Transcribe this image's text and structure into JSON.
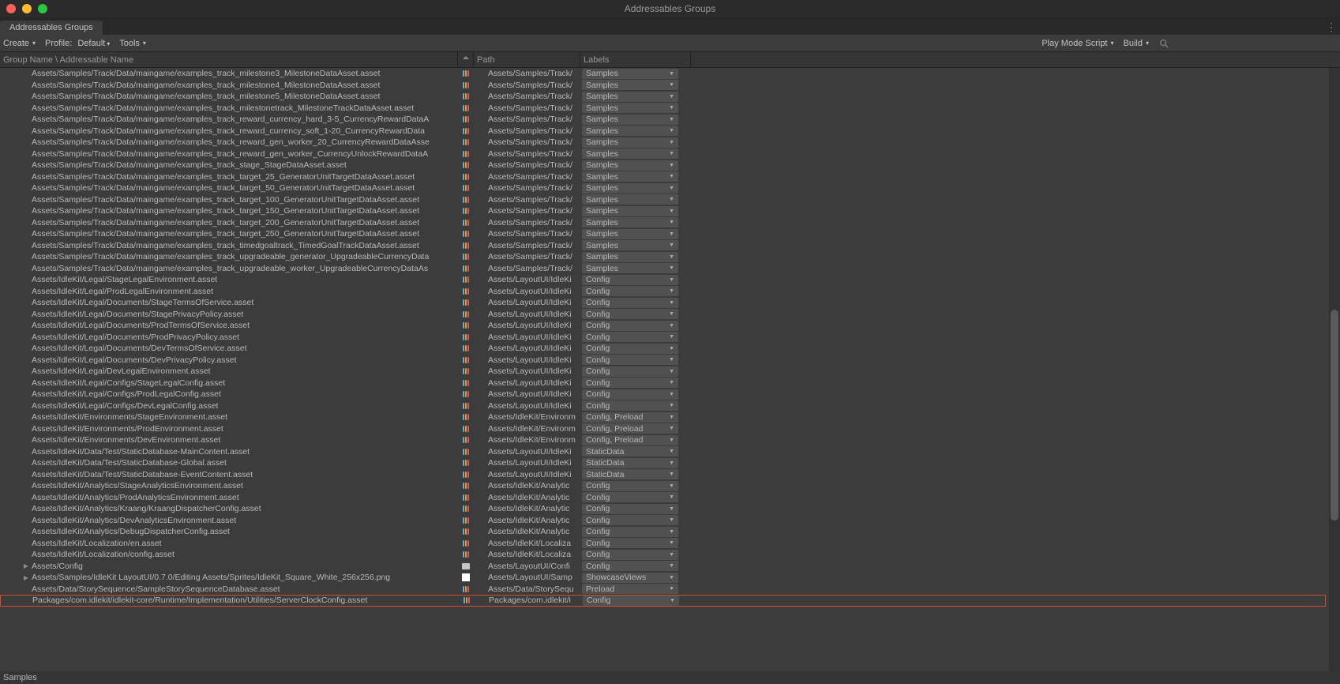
{
  "window": {
    "title": "Addressables Groups"
  },
  "tab": {
    "label": "Addressables Groups"
  },
  "toolbar": {
    "create": "Create",
    "profile_label": "Profile:",
    "profile_value": "Default",
    "tools": "Tools",
    "play_mode": "Play Mode Script",
    "build": "Build"
  },
  "headers": {
    "name": "Group Name \\ Addressable Name",
    "path": "Path",
    "labels": "Labels"
  },
  "rows": [
    {
      "name": "Assets/Samples/Track/Data/maingame/examples_track_milestone3_MilestoneDataAsset.asset",
      "path": "Assets/Samples/Track/",
      "label": "Samples",
      "icon": "asset"
    },
    {
      "name": "Assets/Samples/Track/Data/maingame/examples_track_milestone4_MilestoneDataAsset.asset",
      "path": "Assets/Samples/Track/",
      "label": "Samples",
      "icon": "asset"
    },
    {
      "name": "Assets/Samples/Track/Data/maingame/examples_track_milestone5_MilestoneDataAsset.asset",
      "path": "Assets/Samples/Track/",
      "label": "Samples",
      "icon": "asset"
    },
    {
      "name": "Assets/Samples/Track/Data/maingame/examples_track_milestonetrack_MilestoneTrackDataAsset.asset",
      "path": "Assets/Samples/Track/",
      "label": "Samples",
      "icon": "asset"
    },
    {
      "name": "Assets/Samples/Track/Data/maingame/examples_track_reward_currency_hard_3-5_CurrencyRewardDataA",
      "path": "Assets/Samples/Track/",
      "label": "Samples",
      "icon": "asset"
    },
    {
      "name": "Assets/Samples/Track/Data/maingame/examples_track_reward_currency_soft_1-20_CurrencyRewardData",
      "path": "Assets/Samples/Track/",
      "label": "Samples",
      "icon": "asset"
    },
    {
      "name": "Assets/Samples/Track/Data/maingame/examples_track_reward_gen_worker_20_CurrencyRewardDataAsse",
      "path": "Assets/Samples/Track/",
      "label": "Samples",
      "icon": "asset"
    },
    {
      "name": "Assets/Samples/Track/Data/maingame/examples_track_reward_gen_worker_CurrencyUnlockRewardDataA",
      "path": "Assets/Samples/Track/",
      "label": "Samples",
      "icon": "asset"
    },
    {
      "name": "Assets/Samples/Track/Data/maingame/examples_track_stage_StageDataAsset.asset",
      "path": "Assets/Samples/Track/",
      "label": "Samples",
      "icon": "asset"
    },
    {
      "name": "Assets/Samples/Track/Data/maingame/examples_track_target_25_GeneratorUnitTargetDataAsset.asset",
      "path": "Assets/Samples/Track/",
      "label": "Samples",
      "icon": "asset"
    },
    {
      "name": "Assets/Samples/Track/Data/maingame/examples_track_target_50_GeneratorUnitTargetDataAsset.asset",
      "path": "Assets/Samples/Track/",
      "label": "Samples",
      "icon": "asset"
    },
    {
      "name": "Assets/Samples/Track/Data/maingame/examples_track_target_100_GeneratorUnitTargetDataAsset.asset",
      "path": "Assets/Samples/Track/",
      "label": "Samples",
      "icon": "asset"
    },
    {
      "name": "Assets/Samples/Track/Data/maingame/examples_track_target_150_GeneratorUnitTargetDataAsset.asset",
      "path": "Assets/Samples/Track/",
      "label": "Samples",
      "icon": "asset"
    },
    {
      "name": "Assets/Samples/Track/Data/maingame/examples_track_target_200_GeneratorUnitTargetDataAsset.asset",
      "path": "Assets/Samples/Track/",
      "label": "Samples",
      "icon": "asset"
    },
    {
      "name": "Assets/Samples/Track/Data/maingame/examples_track_target_250_GeneratorUnitTargetDataAsset.asset",
      "path": "Assets/Samples/Track/",
      "label": "Samples",
      "icon": "asset"
    },
    {
      "name": "Assets/Samples/Track/Data/maingame/examples_track_timedgoaltrack_TimedGoalTrackDataAsset.asset",
      "path": "Assets/Samples/Track/",
      "label": "Samples",
      "icon": "asset"
    },
    {
      "name": "Assets/Samples/Track/Data/maingame/examples_track_upgradeable_generator_UpgradeableCurrencyData",
      "path": "Assets/Samples/Track/",
      "label": "Samples",
      "icon": "asset"
    },
    {
      "name": "Assets/Samples/Track/Data/maingame/examples_track_upgradeable_worker_UpgradeableCurrencyDataAs",
      "path": "Assets/Samples/Track/",
      "label": "Samples",
      "icon": "asset"
    },
    {
      "name": "Assets/IdleKit/Legal/StageLegalEnvironment.asset",
      "path": "Assets/LayoutUI/IdleKi",
      "label": "Config",
      "icon": "asset"
    },
    {
      "name": "Assets/IdleKit/Legal/ProdLegalEnvironment.asset",
      "path": "Assets/LayoutUI/IdleKi",
      "label": "Config",
      "icon": "asset"
    },
    {
      "name": "Assets/IdleKit/Legal/Documents/StageTermsOfService.asset",
      "path": "Assets/LayoutUI/IdleKi",
      "label": "Config",
      "icon": "asset"
    },
    {
      "name": "Assets/IdleKit/Legal/Documents/StagePrivacyPolicy.asset",
      "path": "Assets/LayoutUI/IdleKi",
      "label": "Config",
      "icon": "asset"
    },
    {
      "name": "Assets/IdleKit/Legal/Documents/ProdTermsOfService.asset",
      "path": "Assets/LayoutUI/IdleKi",
      "label": "Config",
      "icon": "asset"
    },
    {
      "name": "Assets/IdleKit/Legal/Documents/ProdPrivacyPolicy.asset",
      "path": "Assets/LayoutUI/IdleKi",
      "label": "Config",
      "icon": "asset"
    },
    {
      "name": "Assets/IdleKit/Legal/Documents/DevTermsOfService.asset",
      "path": "Assets/LayoutUI/IdleKi",
      "label": "Config",
      "icon": "asset"
    },
    {
      "name": "Assets/IdleKit/Legal/Documents/DevPrivacyPolicy.asset",
      "path": "Assets/LayoutUI/IdleKi",
      "label": "Config",
      "icon": "asset"
    },
    {
      "name": "Assets/IdleKit/Legal/DevLegalEnvironment.asset",
      "path": "Assets/LayoutUI/IdleKi",
      "label": "Config",
      "icon": "asset"
    },
    {
      "name": "Assets/IdleKit/Legal/Configs/StageLegalConfig.asset",
      "path": "Assets/LayoutUI/IdleKi",
      "label": "Config",
      "icon": "asset"
    },
    {
      "name": "Assets/IdleKit/Legal/Configs/ProdLegalConfig.asset",
      "path": "Assets/LayoutUI/IdleKi",
      "label": "Config",
      "icon": "asset"
    },
    {
      "name": "Assets/IdleKit/Legal/Configs/DevLegalConfig.asset",
      "path": "Assets/LayoutUI/IdleKi",
      "label": "Config",
      "icon": "asset"
    },
    {
      "name": "Assets/IdleKit/Environments/StageEnvironment.asset",
      "path": "Assets/IdleKit/Environm",
      "label": "Config, Preload",
      "icon": "asset"
    },
    {
      "name": "Assets/IdleKit/Environments/ProdEnvironment.asset",
      "path": "Assets/IdleKit/Environm",
      "label": "Config, Preload",
      "icon": "asset"
    },
    {
      "name": "Assets/IdleKit/Environments/DevEnvironment.asset",
      "path": "Assets/IdleKit/Environm",
      "label": "Config, Preload",
      "icon": "asset"
    },
    {
      "name": "Assets/IdleKit/Data/Test/StaticDatabase-MainContent.asset",
      "path": "Assets/LayoutUI/IdleKi",
      "label": "StaticData",
      "icon": "asset"
    },
    {
      "name": "Assets/IdleKit/Data/Test/StaticDatabase-Global.asset",
      "path": "Assets/LayoutUI/IdleKi",
      "label": "StaticData",
      "icon": "asset"
    },
    {
      "name": "Assets/IdleKit/Data/Test/StaticDatabase-EventContent.asset",
      "path": "Assets/LayoutUI/IdleKi",
      "label": "StaticData",
      "icon": "asset"
    },
    {
      "name": "Assets/IdleKit/Analytics/StageAnalyticsEnvironment.asset",
      "path": "Assets/IdleKit/Analytic",
      "label": "Config",
      "icon": "asset"
    },
    {
      "name": "Assets/IdleKit/Analytics/ProdAnalyticsEnvironment.asset",
      "path": "Assets/IdleKit/Analytic",
      "label": "Config",
      "icon": "asset"
    },
    {
      "name": "Assets/IdleKit/Analytics/Kraang/KraangDispatcherConfig.asset",
      "path": "Assets/IdleKit/Analytic",
      "label": "Config",
      "icon": "asset"
    },
    {
      "name": "Assets/IdleKit/Analytics/DevAnalyticsEnvironment.asset",
      "path": "Assets/IdleKit/Analytic",
      "label": "Config",
      "icon": "asset"
    },
    {
      "name": "Assets/IdleKit/Analytics/DebugDispatcherConfig.asset",
      "path": "Assets/IdleKit/Analytic",
      "label": "Config",
      "icon": "asset"
    },
    {
      "name": "Assets/IdleKit/Localization/en.asset",
      "path": "Assets/IdleKit/Localiza",
      "label": "Config",
      "icon": "asset"
    },
    {
      "name": "Assets/IdleKit/Localization/config.asset",
      "path": "Assets/IdleKit/Localiza",
      "label": "Config",
      "icon": "asset"
    },
    {
      "name": "Assets/Config",
      "path": "Assets/LayoutUI/Confi",
      "label": "Config",
      "icon": "folder",
      "expander": true
    },
    {
      "name": "Assets/Samples/IdleKit LayoutUI/0.7.0/Editing Assets/Sprites/IdleKit_Square_White_256x256.png",
      "path": "Assets/LayoutUI/Samp",
      "label": "ShowcaseViews",
      "icon": "white",
      "expander": true
    },
    {
      "name": "Assets/Data/StorySequence/SampleStorySequenceDatabase.asset",
      "path": "Assets/Data/StorySequ",
      "label": "Preload",
      "icon": "asset"
    },
    {
      "name": "Packages/com.idlekit/idlekit-core/Runtime/Implementation/Utilities/ServerClockConfig.asset",
      "path": "Packages/com.idlekit/i",
      "label": "Config",
      "icon": "asset",
      "highlighted": true
    }
  ],
  "footer": {
    "text": "Samples"
  }
}
